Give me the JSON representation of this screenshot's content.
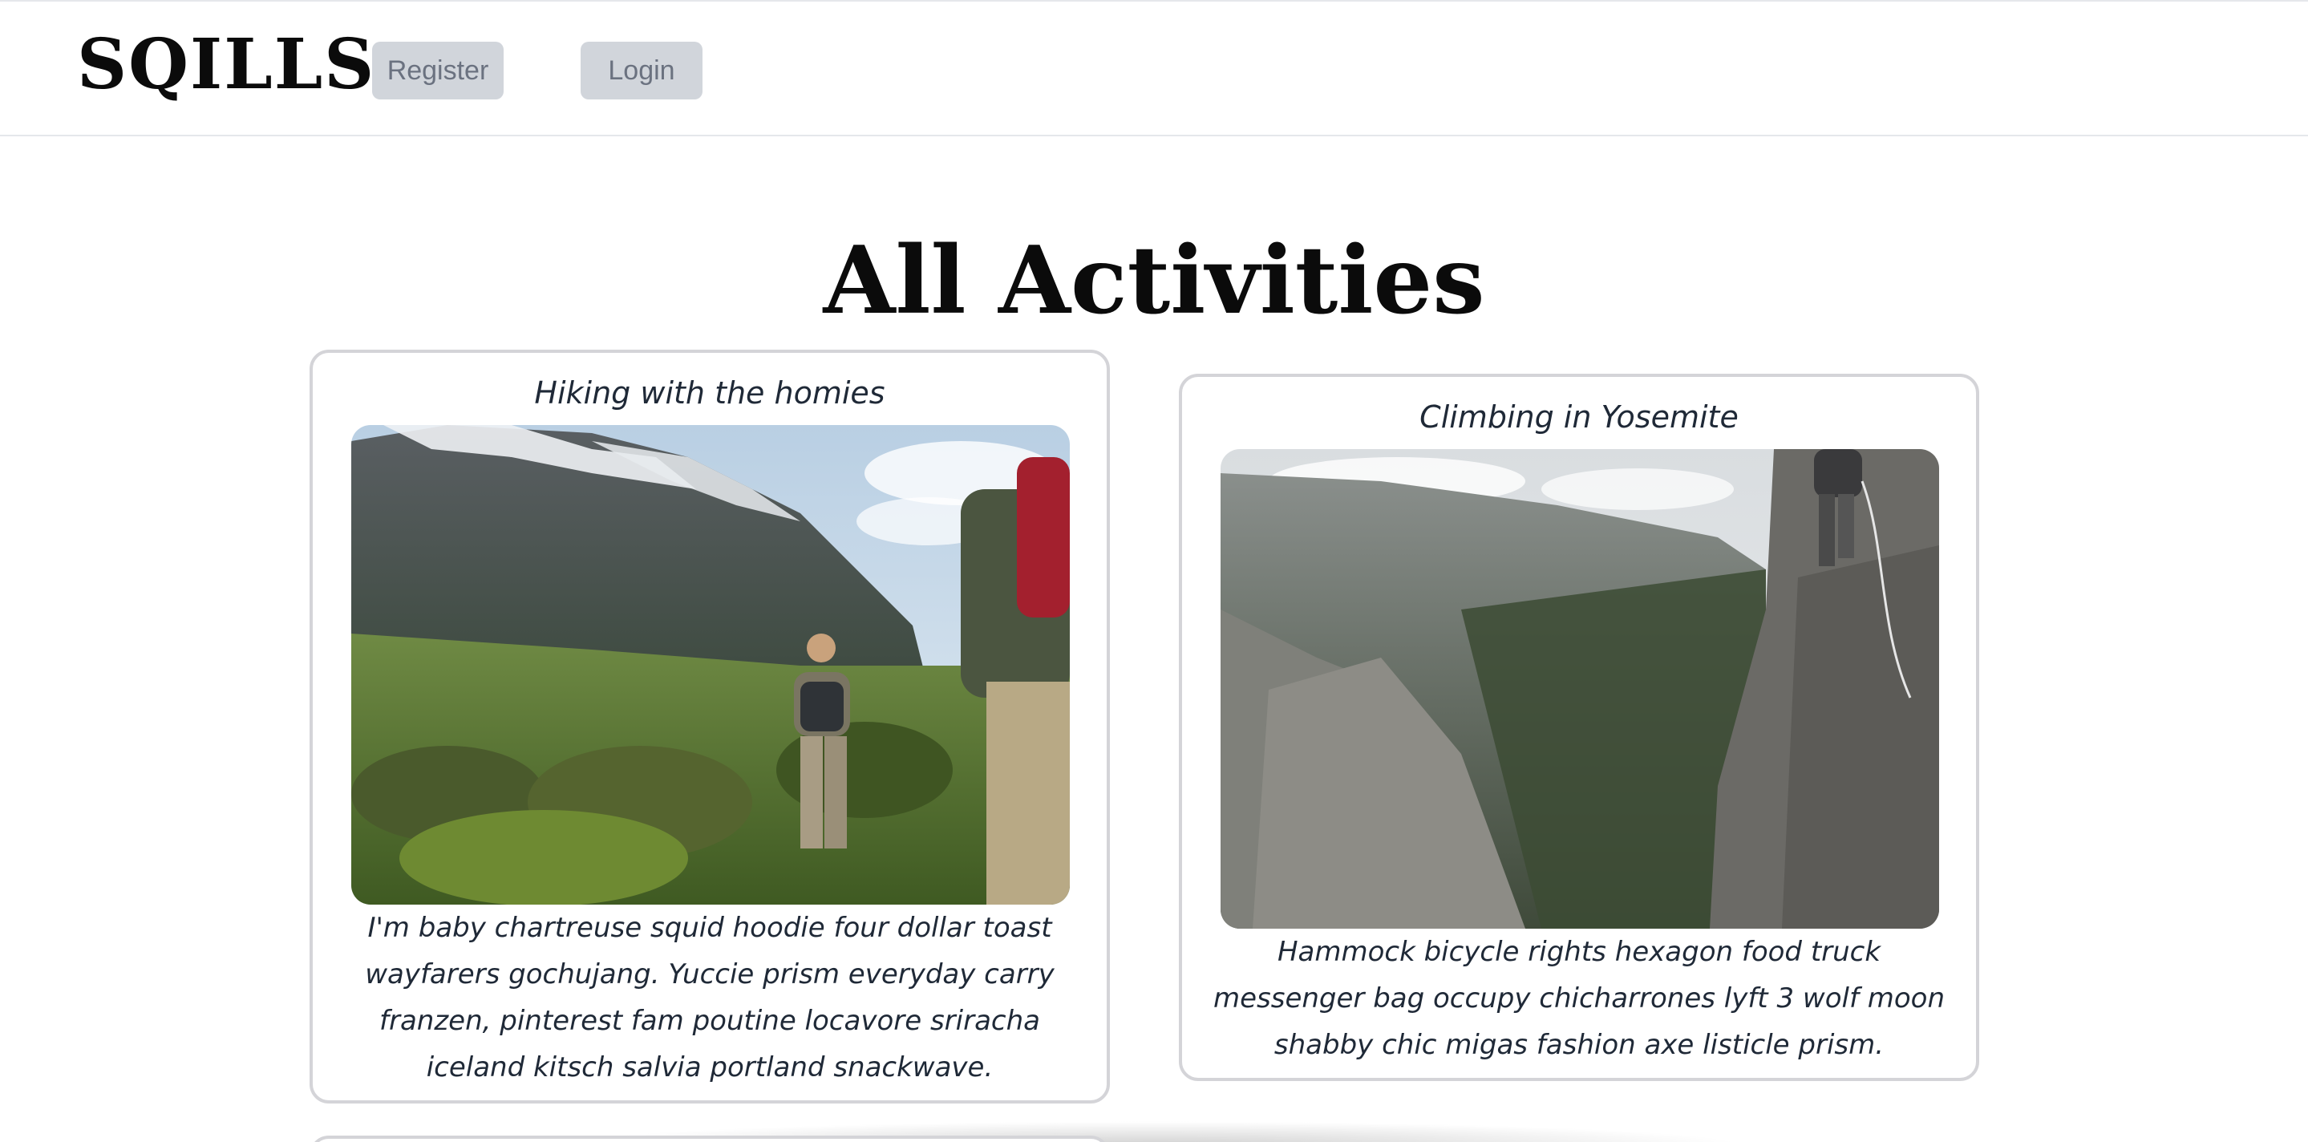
{
  "header": {
    "logo": "SQILLS",
    "register_label": "Register",
    "login_label": "Login"
  },
  "main": {
    "title": "All Activities",
    "activities": [
      {
        "title": "Hiking with the homies",
        "description": "I'm baby chartreuse squid hoodie four dollar toast wayfarers gochujang. Yuccie prism everyday carry franzen, pinterest fam poutine locavore sriracha iceland kitsch salvia portland snackwave."
      },
      {
        "title": "Climbing in Yosemite",
        "description": "Hammock bicycle rights hexagon food truck messenger bag occupy chicharrones lyft 3 wolf moon shabby chic migas fashion axe listicle prism."
      }
    ]
  },
  "colors": {
    "button_bg": "#d1d5db",
    "button_text": "#6b7280",
    "card_border": "#d4d4d8",
    "text": "#1f2937"
  }
}
